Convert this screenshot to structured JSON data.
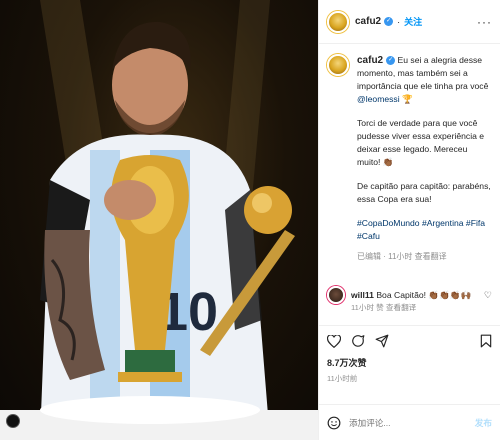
{
  "post": {
    "username": "cafu2",
    "follow_label": "关注",
    "caption_p1": "Eu sei a alegria desse momento, mas também sei a importância que ele tinha pra você",
    "caption_mention": "@leomessi",
    "caption_p1_emoji": "🏆",
    "caption_p2": "Torci de verdade para que você pudesse viver essa experiência e deixar esse legado. Mereceu muito!",
    "caption_p2_emoji": "👏🏾",
    "caption_p3": "De capitão para capitão: parabéns, essa Copa era sua!",
    "hashtags": "#CopaDoMundo #Argentina #Fifa #Cafu",
    "caption_meta": "已编辑 · 11小时  查看翻译",
    "likes": "8.7万次赞",
    "time_ago": "11小时前"
  },
  "comment": {
    "username": "will11",
    "text": "Boa Capitão! 👏🏾👏🏾👏🏾🙌🏾",
    "meta": "11小时  赞 查看翻译"
  },
  "add_comment": {
    "placeholder": "添加评论...",
    "post_label": "发布"
  },
  "icons": {
    "more": "more-icon",
    "heart": "heart-icon",
    "comment": "comment-icon",
    "share": "share-icon",
    "save": "bookmark-icon",
    "emoji": "emoji-icon",
    "user_tag": "user-tag-icon"
  },
  "colors": {
    "accent": "#0095f6",
    "verified": "#3897f0",
    "muted": "#8e8e8e"
  }
}
